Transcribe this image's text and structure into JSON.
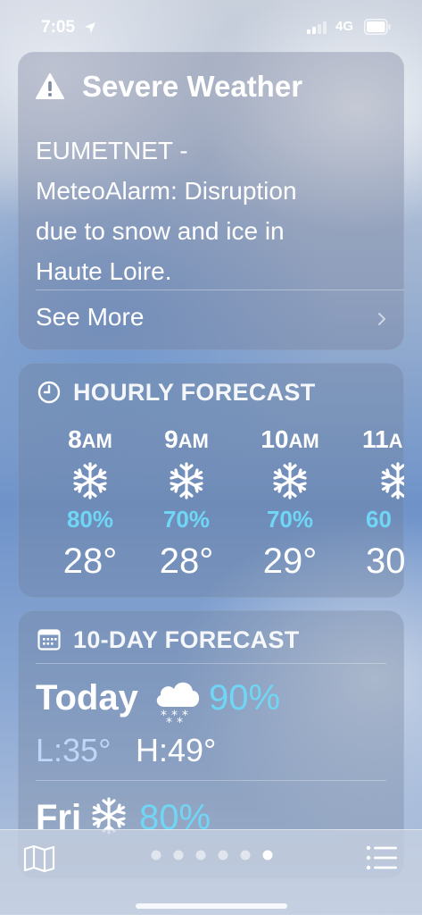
{
  "status_bar": {
    "time": "7:05",
    "network": "4G"
  },
  "severe_weather": {
    "title": "Severe Weather",
    "body": "EUMETNET -\nMeteoAlarm: Disruption\ndue to snow and ice in\nHaute Loire.",
    "see_more": "See More"
  },
  "hourly": {
    "title": "HOURLY FORECAST",
    "items": [
      {
        "hour": "8",
        "ampm": "AM",
        "condition": "snowflake-icon",
        "precip": "80%",
        "temp": "28°"
      },
      {
        "hour": "9",
        "ampm": "AM",
        "condition": "snowflake-icon",
        "precip": "70%",
        "temp": "28°"
      },
      {
        "hour": "10",
        "ampm": "AM",
        "condition": "snowflake-icon",
        "precip": "70%",
        "temp": "29°"
      },
      {
        "hour": "11",
        "ampm": "A",
        "condition": "snowflake-icon",
        "precip": "60",
        "temp": "30"
      }
    ]
  },
  "ten_day": {
    "title": "10-DAY FORECAST",
    "days": [
      {
        "name": "Today",
        "condition": "cloud-snow-icon",
        "precip": "90%",
        "low": "L:35°",
        "high": "H:49°"
      },
      {
        "name": "Fri",
        "condition": "snowflake-icon",
        "precip": "80%"
      }
    ]
  },
  "pager": {
    "count": 6,
    "active": 5
  },
  "colors": {
    "precip_text": "#6fd6f5",
    "card_bg": "rgba(110,125,150,0.32)"
  }
}
